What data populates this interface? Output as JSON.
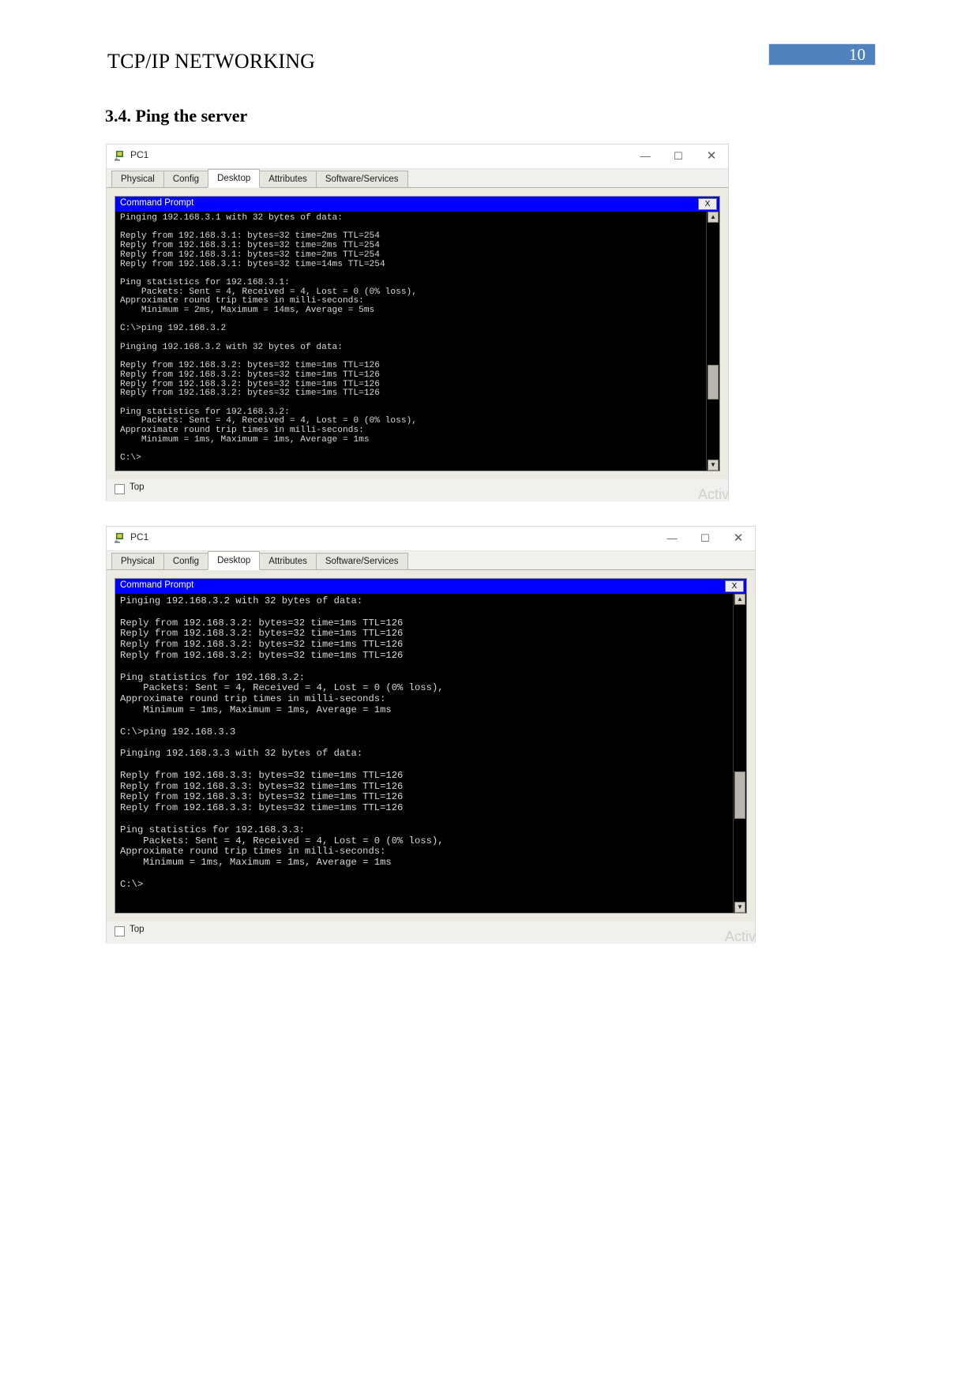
{
  "document": {
    "header_title": "TCP/IP NETWORKING",
    "page_number": "10",
    "page_badge_color": "#4F81BD",
    "section_heading": "3.4. Ping the server"
  },
  "windows": [
    {
      "title": "PC1",
      "app_icon": "pc-device-icon",
      "controls": {
        "minimize": "—",
        "maximize": "☐",
        "close": "✕"
      },
      "tabs": [
        {
          "label": "Physical",
          "active": false
        },
        {
          "label": "Config",
          "active": false
        },
        {
          "label": "Desktop",
          "active": true
        },
        {
          "label": "Attributes",
          "active": false
        },
        {
          "label": "Software/Services",
          "active": false
        }
      ],
      "command_prompt": {
        "title": "Command Prompt",
        "close_label": "X",
        "output": "Pinging 192.168.3.1 with 32 bytes of data:\n\nReply from 192.168.3.1: bytes=32 time=2ms TTL=254\nReply from 192.168.3.1: bytes=32 time=2ms TTL=254\nReply from 192.168.3.1: bytes=32 time=2ms TTL=254\nReply from 192.168.3.1: bytes=32 time=14ms TTL=254\n\nPing statistics for 192.168.3.1:\n    Packets: Sent = 4, Received = 4, Lost = 0 (0% loss),\nApproximate round trip times in milli-seconds:\n    Minimum = 2ms, Maximum = 14ms, Average = 5ms\n\nC:\\>ping 192.168.3.2\n\nPinging 192.168.3.2 with 32 bytes of data:\n\nReply from 192.168.3.2: bytes=32 time=1ms TTL=126\nReply from 192.168.3.2: bytes=32 time=1ms TTL=126\nReply from 192.168.3.2: bytes=32 time=1ms TTL=126\nReply from 192.168.3.2: bytes=32 time=1ms TTL=126\n\nPing statistics for 192.168.3.2:\n    Packets: Sent = 4, Received = 4, Lost = 0 (0% loss),\nApproximate round trip times in milli-seconds:\n    Minimum = 1ms, Maximum = 1ms, Average = 1ms\n\nC:\\>",
        "scroll_up": "▲",
        "scroll_down": "▼"
      },
      "footer": {
        "checkbox_label": "Top",
        "checkbox_checked": false,
        "watermark": "Activ"
      }
    },
    {
      "title": "PC1",
      "app_icon": "pc-device-icon",
      "controls": {
        "minimize": "—",
        "maximize": "☐",
        "close": "✕"
      },
      "tabs": [
        {
          "label": "Physical",
          "active": false
        },
        {
          "label": "Config",
          "active": false
        },
        {
          "label": "Desktop",
          "active": true
        },
        {
          "label": "Attributes",
          "active": false
        },
        {
          "label": "Software/Services",
          "active": false
        }
      ],
      "command_prompt": {
        "title": "Command Prompt",
        "close_label": "X",
        "output": "Pinging 192.168.3.2 with 32 bytes of data:\n\nReply from 192.168.3.2: bytes=32 time=1ms TTL=126\nReply from 192.168.3.2: bytes=32 time=1ms TTL=126\nReply from 192.168.3.2: bytes=32 time=1ms TTL=126\nReply from 192.168.3.2: bytes=32 time=1ms TTL=126\n\nPing statistics for 192.168.3.2:\n    Packets: Sent = 4, Received = 4, Lost = 0 (0% loss),\nApproximate round trip times in milli-seconds:\n    Minimum = 1ms, Maximum = 1ms, Average = 1ms\n\nC:\\>ping 192.168.3.3\n\nPinging 192.168.3.3 with 32 bytes of data:\n\nReply from 192.168.3.3: bytes=32 time=1ms TTL=126\nReply from 192.168.3.3: bytes=32 time=1ms TTL=126\nReply from 192.168.3.3: bytes=32 time=1ms TTL=126\nReply from 192.168.3.3: bytes=32 time=1ms TTL=126\n\nPing statistics for 192.168.3.3:\n    Packets: Sent = 4, Received = 4, Lost = 0 (0% loss),\nApproximate round trip times in milli-seconds:\n    Minimum = 1ms, Maximum = 1ms, Average = 1ms\n\nC:\\>",
        "scroll_up": "▲",
        "scroll_down": "▼"
      },
      "footer": {
        "checkbox_label": "Top",
        "checkbox_checked": false,
        "watermark": "Activ"
      }
    }
  ]
}
